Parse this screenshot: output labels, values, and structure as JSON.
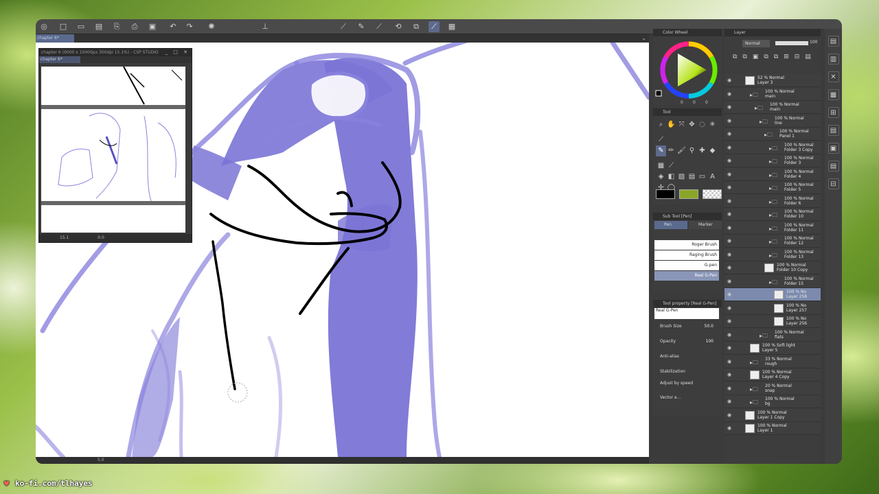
{
  "doc_tab": "chapter 6*",
  "navigator": {
    "title": "chapter 6 (6000 x 10000px 300dpi 15.1%) - CSP STUDIO",
    "tab": "chapter 6*",
    "zoom": "15.1",
    "rotation": "0.0"
  },
  "canvas_status": {
    "zoom": "5.0"
  },
  "color_panel": {
    "title": "Color Wheel",
    "values": [
      "0",
      "0",
      "0"
    ]
  },
  "tool_panel": {
    "title": "Tool"
  },
  "subtool_panel": {
    "title": "Sub Tool [Pen]",
    "tabs": [
      "Pen",
      "Marker"
    ],
    "brushes": [
      "Roger Brush",
      "Raging Brush",
      "G-pen",
      "Real G-Pen"
    ]
  },
  "toolprop_panel": {
    "title": "Tool property [Real G-Pen]",
    "brush_name": "Real G-Pen",
    "brush_size_label": "Brush Size",
    "brush_size_value": "50.0",
    "opacity_label": "Opacity",
    "opacity_value": "100",
    "antialias_label": "Anti-alias",
    "stabilization_label": "Stabilization",
    "adjust_label": "Adjust by speed",
    "vector_label": "Vector e..."
  },
  "layer_panel": {
    "title": "Layer",
    "blend_mode": "Normal",
    "opacity": "100",
    "layers": [
      {
        "line1": "52 % Normal",
        "line2": "Layer 3",
        "indent": 0,
        "type": "layer"
      },
      {
        "line1": "100 % Normal",
        "line2": "main",
        "indent": 1,
        "type": "folder"
      },
      {
        "line1": "100 % Normal",
        "line2": "main",
        "indent": 2,
        "type": "folder"
      },
      {
        "line1": "100 % Normal",
        "line2": "line",
        "indent": 3,
        "type": "folder"
      },
      {
        "line1": "100 % Normal",
        "line2": "Panel 1",
        "indent": 4,
        "type": "folder"
      },
      {
        "line1": "100 % Normal",
        "line2": "Folder 3 Copy",
        "indent": 5,
        "type": "folder"
      },
      {
        "line1": "100 % Normal",
        "line2": "Folder 3",
        "indent": 5,
        "type": "folder"
      },
      {
        "line1": "100 % Normal",
        "line2": "Folder 4",
        "indent": 5,
        "type": "folder"
      },
      {
        "line1": "100 % Normal",
        "line2": "Folder 5",
        "indent": 5,
        "type": "folder"
      },
      {
        "line1": "100 % Normal",
        "line2": "Folder 6",
        "indent": 5,
        "type": "folder"
      },
      {
        "line1": "100 % Normal",
        "line2": "Folder 10",
        "indent": 5,
        "type": "folder"
      },
      {
        "line1": "100 % Normal",
        "line2": "Folder 11",
        "indent": 5,
        "type": "folder"
      },
      {
        "line1": "100 % Normal",
        "line2": "Folder 12",
        "indent": 5,
        "type": "folder"
      },
      {
        "line1": "100 % Normal",
        "line2": "Folder 13",
        "indent": 5,
        "type": "folder"
      },
      {
        "line1": "100 % Normal",
        "line2": "Folder 10 Copy",
        "indent": 4,
        "type": "layer"
      },
      {
        "line1": "100 % Normal",
        "line2": "Folder 15",
        "indent": 5,
        "type": "folder"
      },
      {
        "line1": "100 % No",
        "line2": "Layer 258",
        "indent": 6,
        "type": "layer",
        "selected": true
      },
      {
        "line1": "100 % No",
        "line2": "Layer 257",
        "indent": 6,
        "type": "layer"
      },
      {
        "line1": "100 % No",
        "line2": "Layer 256",
        "indent": 6,
        "type": "layer"
      },
      {
        "line1": "100 % Normal",
        "line2": "flats",
        "indent": 3,
        "type": "folder"
      },
      {
        "line1": "100 % Soft light",
        "line2": "Layer 5",
        "indent": 1,
        "type": "layer"
      },
      {
        "line1": "33 % Normal",
        "line2": "rough",
        "indent": 1,
        "type": "folder"
      },
      {
        "line1": "100 % Normal",
        "line2": "Layer 4 Copy",
        "indent": 1,
        "type": "layer"
      },
      {
        "line1": "20 % Normal",
        "line2": "snap",
        "indent": 1,
        "type": "folder"
      },
      {
        "line1": "100 % Normal",
        "line2": "bg",
        "indent": 1,
        "type": "folder"
      },
      {
        "line1": "100 % Normal",
        "line2": "Layer 1 Copy",
        "indent": 0,
        "type": "layer"
      },
      {
        "line1": "100 % Normal",
        "line2": "Layer 1",
        "indent": 0,
        "type": "layer"
      }
    ]
  },
  "overlay": {
    "kofi": "ko-fi.com/tlhayes"
  },
  "colors": {
    "accent": "#5d6a8c",
    "sketch": "#7b74d6",
    "main": "#000000",
    "sub": "#8aa628"
  }
}
